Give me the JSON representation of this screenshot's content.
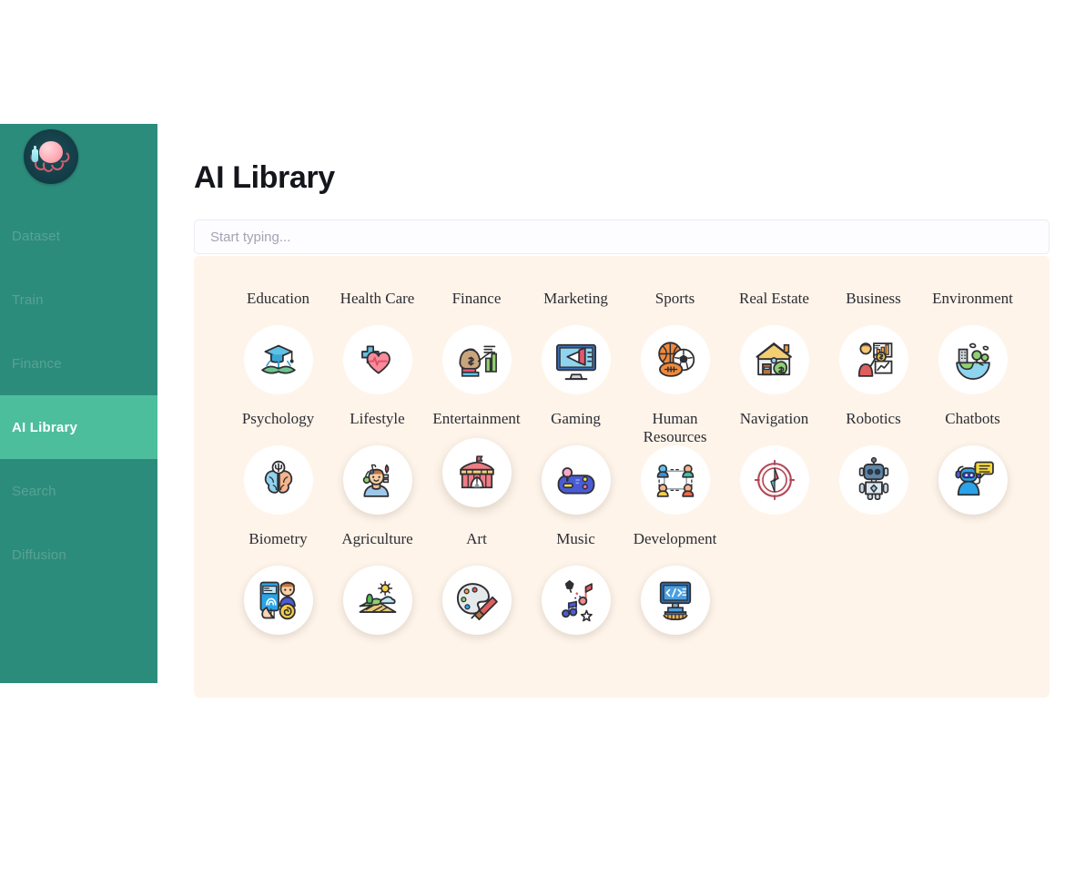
{
  "sidebar": {
    "logo": {
      "name": "octopus-logo",
      "bg": "#143a44",
      "accent": "#ef8a99"
    },
    "items": [
      {
        "label": "Dataset",
        "active": false
      },
      {
        "label": "Train",
        "active": false
      },
      {
        "label": "Finance",
        "active": false
      },
      {
        "label": "AI Library",
        "active": true
      },
      {
        "label": "Search",
        "active": false
      },
      {
        "label": "Diffusion",
        "active": false
      }
    ],
    "bg": "#2C8C7C",
    "active_bg": "#4DBE9C",
    "inactive_text": "#58A294"
  },
  "main": {
    "title": "AI Library",
    "search": {
      "value": "",
      "placeholder": "Start typing..."
    },
    "panel_bg": "#FEF4EA"
  },
  "categories": [
    {
      "label": "Education",
      "icon": "graduation-book-icon",
      "state": "normal"
    },
    {
      "label": "Health Care",
      "icon": "heart-cross-icon",
      "state": "normal"
    },
    {
      "label": "Finance",
      "icon": "money-bag-chart-icon",
      "state": "normal"
    },
    {
      "label": "Marketing",
      "icon": "monitor-megaphone-icon",
      "state": "normal"
    },
    {
      "label": "Sports",
      "icon": "sports-balls-icon",
      "state": "normal"
    },
    {
      "label": "Real Estate",
      "icon": "house-money-icon",
      "state": "normal"
    },
    {
      "label": "Business",
      "icon": "presenter-chart-icon",
      "state": "normal"
    },
    {
      "label": "Environment",
      "icon": "earth-tree-icon",
      "state": "normal"
    },
    {
      "label": "Psychology",
      "icon": "brain-psi-icon",
      "state": "normal"
    },
    {
      "label": "Lifestyle",
      "icon": "person-music-icon",
      "state": "shadowed"
    },
    {
      "label": "Entertainment",
      "icon": "circus-tent-icon",
      "state": "raised"
    },
    {
      "label": "Gaming",
      "icon": "gamepad-icon",
      "state": "shadowed"
    },
    {
      "label": "Human Resources",
      "icon": "team-network-icon",
      "state": "normal"
    },
    {
      "label": "Navigation",
      "icon": "compass-icon",
      "state": "normal"
    },
    {
      "label": "Robotics",
      "icon": "robot-icon",
      "state": "normal"
    },
    {
      "label": "Chatbots",
      "icon": "chatbot-bubble-icon",
      "state": "shadowed"
    },
    {
      "label": "Biometry",
      "icon": "fingerprint-phone-icon",
      "state": "shadowed"
    },
    {
      "label": "Agriculture",
      "icon": "farm-field-icon",
      "state": "shadowed"
    },
    {
      "label": "Art",
      "icon": "palette-brush-icon",
      "state": "shadowed"
    },
    {
      "label": "Music",
      "icon": "music-notes-icon",
      "state": "shadowed"
    },
    {
      "label": "Development",
      "icon": "code-monitor-icon",
      "state": "shadowed"
    }
  ]
}
